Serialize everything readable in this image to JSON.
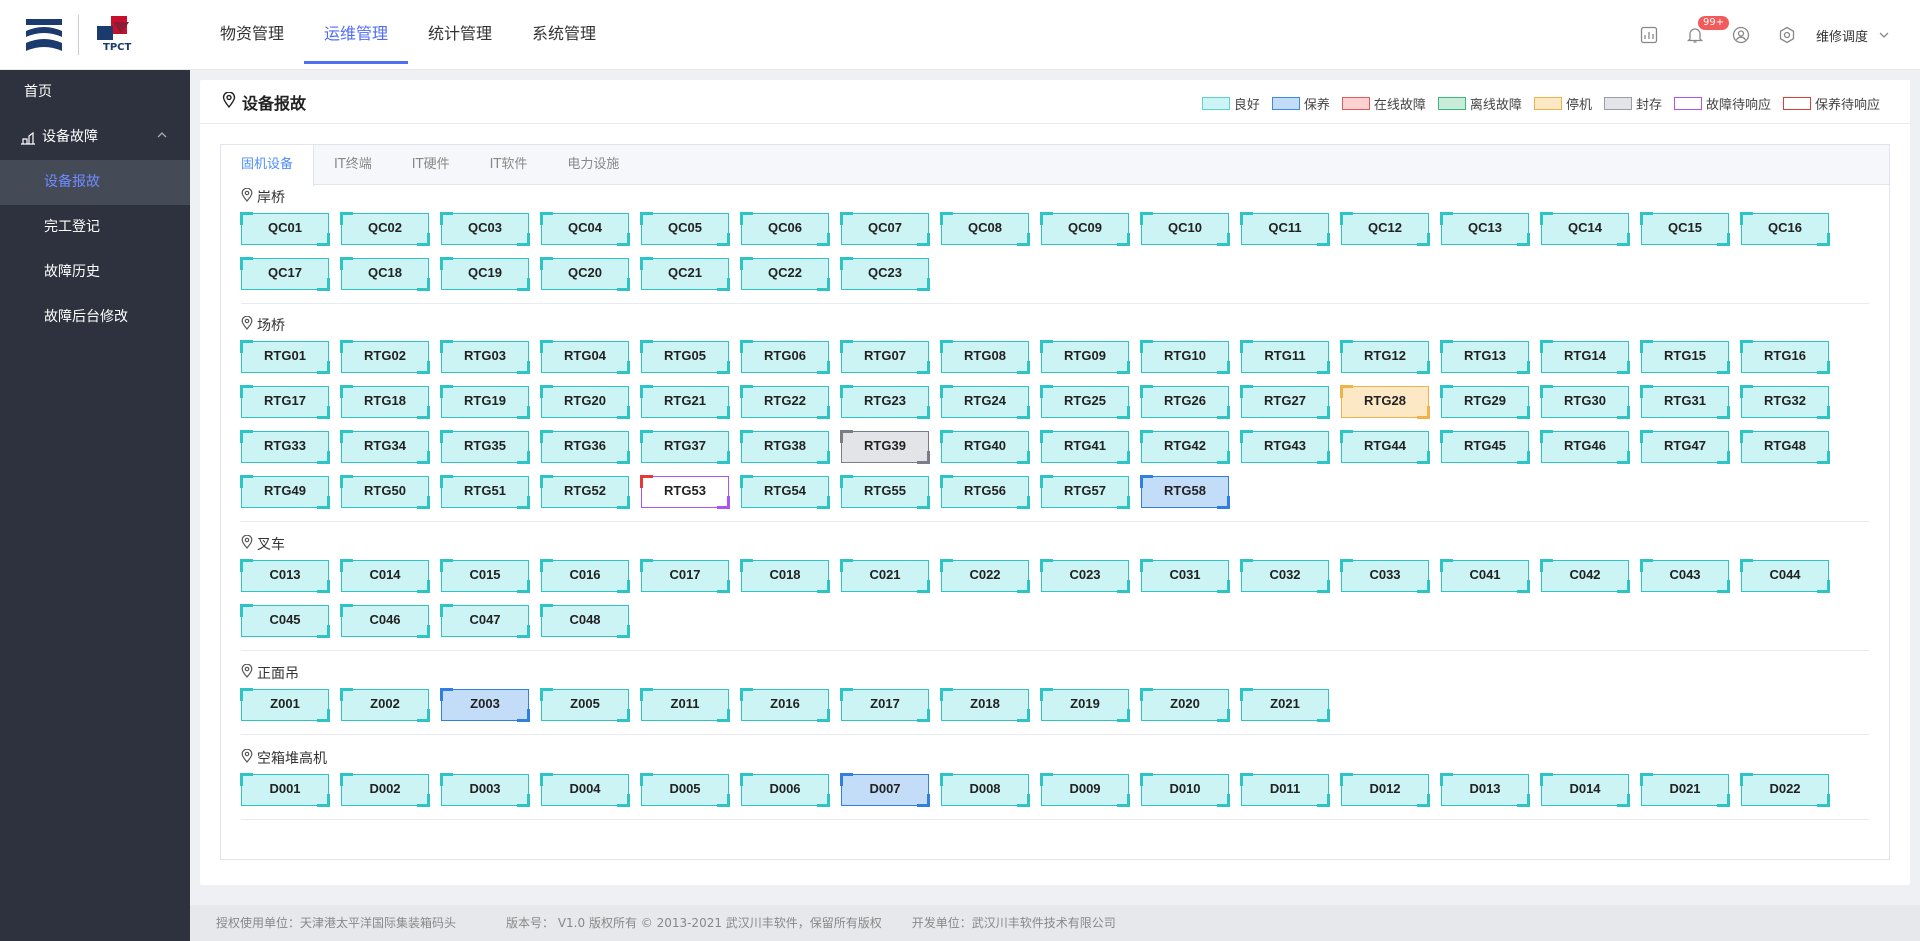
{
  "header": {
    "logo_text": "TPCT",
    "nav": [
      {
        "label": "物资管理",
        "active": false
      },
      {
        "label": "运维管理",
        "active": true
      },
      {
        "label": "统计管理",
        "active": false
      },
      {
        "label": "系统管理",
        "active": false
      }
    ],
    "notif_badge": "99+",
    "user": "维修调度"
  },
  "sidebar": {
    "home": "首页",
    "group": "设备故障",
    "items": [
      {
        "label": "设备报故",
        "active": true
      },
      {
        "label": "完工登记",
        "active": false
      },
      {
        "label": "故障历史",
        "active": false
      },
      {
        "label": "故障后台修改",
        "active": false
      }
    ]
  },
  "page": {
    "title": "设备报故",
    "legend": [
      {
        "label": "良好",
        "fill": "#cdf4f4",
        "border": "#5dd3d3"
      },
      {
        "label": "保养",
        "fill": "#c3dcf7",
        "border": "#3e8ae0"
      },
      {
        "label": "在线故障",
        "fill": "#fbd1d1",
        "border": "#e65a5a"
      },
      {
        "label": "离线故障",
        "fill": "#c9ecd8",
        "border": "#3db87a"
      },
      {
        "label": "停机",
        "fill": "#fde8c6",
        "border": "#f0b24a"
      },
      {
        "label": "封存",
        "fill": "#e3e4e8",
        "border": "#9a9ca6"
      },
      {
        "label": "故障待响应",
        "fill": "#ffffff",
        "border": "#a855f7"
      },
      {
        "label": "保养待响应",
        "fill": "#ffffff",
        "border": "#e53935"
      }
    ],
    "tabs": [
      {
        "label": "固机设备",
        "active": true
      },
      {
        "label": "IT终端",
        "active": false
      },
      {
        "label": "IT硬件",
        "active": false
      },
      {
        "label": "IT软件",
        "active": false
      },
      {
        "label": "电力设施",
        "active": false
      }
    ]
  },
  "sections": [
    {
      "title": "岸桥",
      "items": [
        {
          "name": "QC01",
          "status": "good"
        },
        {
          "name": "QC02",
          "status": "good"
        },
        {
          "name": "QC03",
          "status": "good"
        },
        {
          "name": "QC04",
          "status": "good"
        },
        {
          "name": "QC05",
          "status": "good"
        },
        {
          "name": "QC06",
          "status": "good"
        },
        {
          "name": "QC07",
          "status": "good"
        },
        {
          "name": "QC08",
          "status": "good"
        },
        {
          "name": "QC09",
          "status": "good"
        },
        {
          "name": "QC10",
          "status": "good"
        },
        {
          "name": "QC11",
          "status": "good"
        },
        {
          "name": "QC12",
          "status": "good"
        },
        {
          "name": "QC13",
          "status": "good"
        },
        {
          "name": "QC14",
          "status": "good"
        },
        {
          "name": "QC15",
          "status": "good"
        },
        {
          "name": "QC16",
          "status": "good"
        },
        {
          "name": "QC17",
          "status": "good"
        },
        {
          "name": "QC18",
          "status": "good"
        },
        {
          "name": "QC19",
          "status": "good"
        },
        {
          "name": "QC20",
          "status": "good"
        },
        {
          "name": "QC21",
          "status": "good"
        },
        {
          "name": "QC22",
          "status": "good"
        },
        {
          "name": "QC23",
          "status": "good"
        }
      ]
    },
    {
      "title": "场桥",
      "items": [
        {
          "name": "RTG01",
          "status": "good"
        },
        {
          "name": "RTG02",
          "status": "good"
        },
        {
          "name": "RTG03",
          "status": "good"
        },
        {
          "name": "RTG04",
          "status": "good"
        },
        {
          "name": "RTG05",
          "status": "good"
        },
        {
          "name": "RTG06",
          "status": "good"
        },
        {
          "name": "RTG07",
          "status": "good"
        },
        {
          "name": "RTG08",
          "status": "good"
        },
        {
          "name": "RTG09",
          "status": "good"
        },
        {
          "name": "RTG10",
          "status": "good"
        },
        {
          "name": "RTG11",
          "status": "good"
        },
        {
          "name": "RTG12",
          "status": "good"
        },
        {
          "name": "RTG13",
          "status": "good"
        },
        {
          "name": "RTG14",
          "status": "good"
        },
        {
          "name": "RTG15",
          "status": "good"
        },
        {
          "name": "RTG16",
          "status": "good"
        },
        {
          "name": "RTG17",
          "status": "good"
        },
        {
          "name": "RTG18",
          "status": "good"
        },
        {
          "name": "RTG19",
          "status": "good"
        },
        {
          "name": "RTG20",
          "status": "good"
        },
        {
          "name": "RTG21",
          "status": "good"
        },
        {
          "name": "RTG22",
          "status": "good"
        },
        {
          "name": "RTG23",
          "status": "good"
        },
        {
          "name": "RTG24",
          "status": "good"
        },
        {
          "name": "RTG25",
          "status": "good"
        },
        {
          "name": "RTG26",
          "status": "good"
        },
        {
          "name": "RTG27",
          "status": "good"
        },
        {
          "name": "RTG28",
          "status": "stop"
        },
        {
          "name": "RTG29",
          "status": "good"
        },
        {
          "name": "RTG30",
          "status": "good"
        },
        {
          "name": "RTG31",
          "status": "good"
        },
        {
          "name": "RTG32",
          "status": "good"
        },
        {
          "name": "RTG33",
          "status": "good"
        },
        {
          "name": "RTG34",
          "status": "good"
        },
        {
          "name": "RTG35",
          "status": "good"
        },
        {
          "name": "RTG36",
          "status": "good"
        },
        {
          "name": "RTG37",
          "status": "good"
        },
        {
          "name": "RTG38",
          "status": "good"
        },
        {
          "name": "RTG39",
          "status": "stored"
        },
        {
          "name": "RTG40",
          "status": "good"
        },
        {
          "name": "RTG41",
          "status": "good"
        },
        {
          "name": "RTG42",
          "status": "good"
        },
        {
          "name": "RTG43",
          "status": "good"
        },
        {
          "name": "RTG44",
          "status": "good"
        },
        {
          "name": "RTG45",
          "status": "good"
        },
        {
          "name": "RTG46",
          "status": "good"
        },
        {
          "name": "RTG47",
          "status": "good"
        },
        {
          "name": "RTG48",
          "status": "good"
        },
        {
          "name": "RTG49",
          "status": "good"
        },
        {
          "name": "RTG50",
          "status": "good"
        },
        {
          "name": "RTG51",
          "status": "good"
        },
        {
          "name": "RTG52",
          "status": "good"
        },
        {
          "name": "RTG53",
          "status": "wait"
        },
        {
          "name": "RTG54",
          "status": "good"
        },
        {
          "name": "RTG55",
          "status": "good"
        },
        {
          "name": "RTG56",
          "status": "good"
        },
        {
          "name": "RTG57",
          "status": "good"
        },
        {
          "name": "RTG58",
          "status": "maint"
        }
      ]
    },
    {
      "title": "叉车",
      "items": [
        {
          "name": "C013",
          "status": "good"
        },
        {
          "name": "C014",
          "status": "good"
        },
        {
          "name": "C015",
          "status": "good"
        },
        {
          "name": "C016",
          "status": "good"
        },
        {
          "name": "C017",
          "status": "good"
        },
        {
          "name": "C018",
          "status": "good"
        },
        {
          "name": "C021",
          "status": "good"
        },
        {
          "name": "C022",
          "status": "good"
        },
        {
          "name": "C023",
          "status": "good"
        },
        {
          "name": "C031",
          "status": "good"
        },
        {
          "name": "C032",
          "status": "good"
        },
        {
          "name": "C033",
          "status": "good"
        },
        {
          "name": "C041",
          "status": "good"
        },
        {
          "name": "C042",
          "status": "good"
        },
        {
          "name": "C043",
          "status": "good"
        },
        {
          "name": "C044",
          "status": "good"
        },
        {
          "name": "C045",
          "status": "good"
        },
        {
          "name": "C046",
          "status": "good"
        },
        {
          "name": "C047",
          "status": "good"
        },
        {
          "name": "C048",
          "status": "good"
        }
      ]
    },
    {
      "title": "正面吊",
      "items": [
        {
          "name": "Z001",
          "status": "good"
        },
        {
          "name": "Z002",
          "status": "good"
        },
        {
          "name": "Z003",
          "status": "maint"
        },
        {
          "name": "Z005",
          "status": "good"
        },
        {
          "name": "Z011",
          "status": "good"
        },
        {
          "name": "Z016",
          "status": "good"
        },
        {
          "name": "Z017",
          "status": "good"
        },
        {
          "name": "Z018",
          "status": "good"
        },
        {
          "name": "Z019",
          "status": "good"
        },
        {
          "name": "Z020",
          "status": "good"
        },
        {
          "name": "Z021",
          "status": "good"
        }
      ]
    },
    {
      "title": "空箱堆高机",
      "items": [
        {
          "name": "D001",
          "status": "good"
        },
        {
          "name": "D002",
          "status": "good"
        },
        {
          "name": "D003",
          "status": "good"
        },
        {
          "name": "D004",
          "status": "good"
        },
        {
          "name": "D005",
          "status": "good"
        },
        {
          "name": "D006",
          "status": "good"
        },
        {
          "name": "D007",
          "status": "maint"
        },
        {
          "name": "D008",
          "status": "good"
        },
        {
          "name": "D009",
          "status": "good"
        },
        {
          "name": "D010",
          "status": "good"
        },
        {
          "name": "D011",
          "status": "good"
        },
        {
          "name": "D012",
          "status": "good"
        },
        {
          "name": "D013",
          "status": "good"
        },
        {
          "name": "D014",
          "status": "good"
        },
        {
          "name": "D021",
          "status": "good"
        },
        {
          "name": "D022",
          "status": "good"
        }
      ]
    }
  ],
  "footer": {
    "licensee": "授权使用单位：天津港太平洋国际集装箱码头",
    "version": "版本号： V1.0   版权所有 © 2013-2021 武汉川丰软件，保留所有版权",
    "developer": "开发单位：武汉川丰软件技术有限公司"
  }
}
